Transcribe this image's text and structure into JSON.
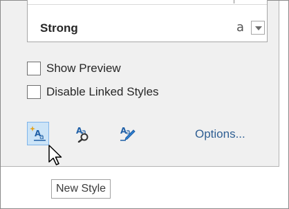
{
  "style_list": {
    "selected_style": "Strong",
    "type_glyph": "a"
  },
  "options": {
    "show_preview": {
      "label": "Show Preview",
      "checked": false
    },
    "disable_linked": {
      "label": "Disable Linked Styles",
      "checked": false
    }
  },
  "toolbar": {
    "new_style_icon": "new-style-icon",
    "style_inspector_icon": "style-inspector-icon",
    "manage_styles_icon": "manage-styles-icon",
    "options_label": "Options..."
  },
  "tooltip": {
    "text": "New Style"
  },
  "colors": {
    "panel_bg": "#f0f0f0",
    "hover_bg": "#cce4f7",
    "hover_border": "#7eb4ea",
    "link": "#2f5f93",
    "icon_blue": "#1f5fa6",
    "icon_sparkle": "#e5a21a"
  }
}
